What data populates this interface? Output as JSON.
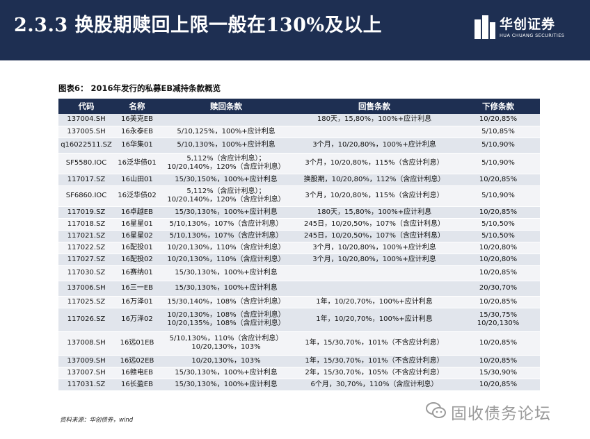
{
  "header": {
    "title": "2.3.3 换股期赎回上限一般在130%及以上",
    "logo_cn": "华创证券",
    "logo_en": "HUA CHUANG SECURITIES"
  },
  "caption": "图表6： 2016年发行的私募EB减持条款概览",
  "table": {
    "columns": [
      "代码",
      "名称",
      "赎回条款",
      "回售条款",
      "下修条款"
    ],
    "rows": [
      {
        "code": "137004.SH",
        "name": "16美克EB",
        "redeem": "",
        "put": "180天，15,80%，100%+应计利息",
        "down": "10/20,85%"
      },
      {
        "code": "137005.SH",
        "name": "16永泰EB",
        "redeem": "5/10,125%，100%+应计利息",
        "put": "",
        "down": "5/10,85%"
      },
      {
        "code": "q16022511.SZ",
        "name": "16华集01",
        "redeem": "5/10,130%，100%+应计利息",
        "put": "3个月，10/20,80%，100%+应计利息",
        "down": "5/10,90%"
      },
      {
        "code": "SF5580.IOC",
        "name": "16泛华债01",
        "redeem": "5,112%（含应计利息）；\n10/20,140%，120%（含应计利息）",
        "put": "3个月，10/20,80%，115%（含应计利息）",
        "down": "5/10,90%"
      },
      {
        "code": "117017.SZ",
        "name": "16山田01",
        "redeem": "15/30,150%，100%+应计利息",
        "put": "换股期，10/20,80%，112%（含应计利息）",
        "down": "10/20,85%"
      },
      {
        "code": "SF6860.IOC",
        "name": "16泛华债02",
        "redeem": "5,112%（含应计利息）；\n10/20,140%，120%（含应计利息）",
        "put": "3个月，10/20,80%，115%（含应计利息）",
        "down": "5/10,90%"
      },
      {
        "code": "117019.SZ",
        "name": "16卓越EB",
        "redeem": "15/30,130%，100%+应计利息",
        "put": "180天，15,80%，100%+应计利息",
        "down": "10/20,85%"
      },
      {
        "code": "117018.SZ",
        "name": "16星星01",
        "redeem": "5/10,130%，107%（含应计利息）",
        "put": "245日，10/20,50%，107%（含应计利息）",
        "down": "5/10,50%"
      },
      {
        "code": "117021.SZ",
        "name": "16星星02",
        "redeem": "5/10,130%，107%（含应计利息）",
        "put": "245日，10/20,50%，107%（含应计利息）",
        "down": "5/10,50%"
      },
      {
        "code": "117022.SZ",
        "name": "16配投01",
        "redeem": "10/20,130%，110%（含应计利息）",
        "put": "3个月，10/20,80%，100%+应计利息",
        "down": "10/20,80%"
      },
      {
        "code": "117027.SZ",
        "name": "16配投02",
        "redeem": "10/20,130%，110%（含应计利息）",
        "put": "3个月，10/20,80%，100%+应计利息",
        "down": "10/20,80%"
      },
      {
        "code": "117030.SZ",
        "name": "16赛纳01",
        "redeem": "15/30,130%，100%+应计利息",
        "put": "",
        "down": "10/20,85%"
      },
      {
        "code": "137006.SH",
        "name": "16三一EB",
        "redeem": "15/30,130%，100%+应计利息",
        "put": "",
        "down": "20/30,70%"
      },
      {
        "code": "117025.SZ",
        "name": "16万泽01",
        "redeem": "15/30,140%，108%（含应计利息）",
        "put": "1年，10/20,70%，100%+应计利息",
        "down": "10/20,85%"
      },
      {
        "code": "117026.SZ",
        "name": "16万泽02",
        "redeem": "10/20,130%，108%（含应计利息）\n10/20,135%，108%（含应计利息）",
        "put": "1年，10/20,70%，100%+应计利息",
        "down": "15/30,75%\n10/20,130%"
      },
      {
        "code": "137008.SH",
        "name": "16远01EB",
        "redeem": "5/10,130%，110%（含应计利息）\n10/20,130%，103%",
        "put": "1年，15/30,70%，101%（不含应计利息）",
        "down": "10/20,85%"
      },
      {
        "code": "137009.SH",
        "name": "16远02EB",
        "redeem": "10/20,130%，103%",
        "put": "1年，15/30,70%，101%（不含应计利息）",
        "down": "10/20,85%"
      },
      {
        "code": "137007.SH",
        "name": "16赣电EB",
        "redeem": "15/30,130%，100%+应计利息",
        "put": "2年，15/30,70%，105%（不含应计利息）",
        "down": "15/30,90%"
      },
      {
        "code": "117031.SZ",
        "name": "16长盈EB",
        "redeem": "15/30,130%，100%+应计利息",
        "put": "6个月，30,70%，110%（含应计利息）",
        "down": "10/20,85%"
      }
    ]
  },
  "source": "资料来源：华创债券，wind",
  "watermark": "固收债务论坛",
  "colors": {
    "header_bg": "#1e2f52",
    "row_odd": "#e1e5ec",
    "row_even": "#f3f4f7"
  }
}
